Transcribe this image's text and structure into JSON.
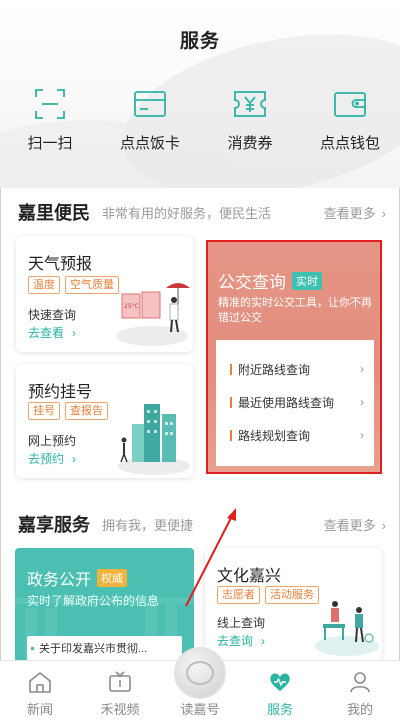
{
  "header": {
    "title": "服务"
  },
  "quick_actions": [
    {
      "label": "扫一扫",
      "icon": "scan-icon"
    },
    {
      "label": "点点饭卡",
      "icon": "meal-card-icon"
    },
    {
      "label": "消费券",
      "icon": "coupon-icon"
    },
    {
      "label": "点点钱包",
      "icon": "wallet-icon"
    }
  ],
  "section1": {
    "title": "嘉里便民",
    "subtitle": "非常有用的好服务，便民生活",
    "more": "查看更多",
    "chevron": "›"
  },
  "weather": {
    "title": "天气预报",
    "tags": [
      "温度",
      "空气质量"
    ],
    "desc": "快速查询",
    "link": "去查看",
    "chevron": "›",
    "illus_temp": "25°C"
  },
  "appointment": {
    "title": "预约挂号",
    "tags": [
      "挂号",
      "查报告"
    ],
    "desc": "网上预约",
    "link": "去预约",
    "chevron": "›"
  },
  "bus": {
    "title": "公交查询",
    "badge": "实时",
    "desc": "精准的实时公交工具，让你不再错过公交",
    "rows": [
      "附近路线查询",
      "最近使用路线查询",
      "路线规划查询"
    ],
    "chevron": "›",
    "highlight_color": "#e02020"
  },
  "section2": {
    "title": "嘉享服务",
    "subtitle": "拥有我，更便捷",
    "more": "查看更多",
    "chevron": "›"
  },
  "gov": {
    "title": "政务公开",
    "badge": "权威",
    "desc": "实时了解政府公布的信息",
    "news": "关于印发嘉兴市贯彻..."
  },
  "culture": {
    "title": "文化嘉兴",
    "tags": [
      "志愿者",
      "活动服务"
    ],
    "desc": "线上查询",
    "link": "去查询",
    "chevron": "›"
  },
  "bottom_nav": [
    {
      "label": "新闻",
      "icon": "home-icon",
      "active": false
    },
    {
      "label": "禾视频",
      "icon": "tv-icon",
      "active": false
    },
    {
      "label": "读嘉号",
      "icon": "logo-icon",
      "active": false
    },
    {
      "label": "服务",
      "icon": "heart-icon",
      "active": true
    },
    {
      "label": "我的",
      "icon": "user-icon",
      "active": false
    }
  ],
  "colors": {
    "accent": "#2bb3a4",
    "orange": "#e8803a",
    "bus_bg": "#e49585",
    "gov_bg": "#4bbfb2",
    "annotation": "#e02020"
  }
}
